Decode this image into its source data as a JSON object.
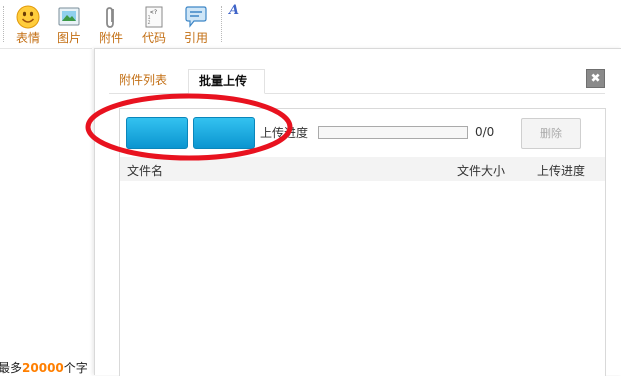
{
  "toolbar": {
    "items": [
      {
        "icon": "smiley-icon",
        "label": "表情"
      },
      {
        "icon": "image-icon",
        "label": "图片"
      },
      {
        "icon": "paperclip-icon",
        "label": "附件"
      },
      {
        "icon": "code-icon",
        "label": "代码"
      },
      {
        "icon": "quote-icon",
        "label": "引用"
      }
    ],
    "font_button": "A"
  },
  "editor": {
    "limit_prefix": "最多",
    "limit_value": "20000",
    "limit_suffix": "个字"
  },
  "dialog": {
    "close_symbol": "✖",
    "tabs": [
      {
        "label": "附件列表",
        "active": false
      },
      {
        "label": "批量上传",
        "active": true
      }
    ],
    "upload": {
      "progress_label": "上传进度",
      "progress_fraction": 0,
      "progress_count": "0/0",
      "delete_label": "删除"
    },
    "columns": {
      "name": "文件名",
      "size": "文件大小",
      "progress": "上传进度"
    }
  },
  "colors": {
    "toolbar_label": "#c36f14",
    "accent_blue": "#1ba7e0",
    "annotation_red": "#e8121f",
    "limit_number": "#ff7f00"
  }
}
